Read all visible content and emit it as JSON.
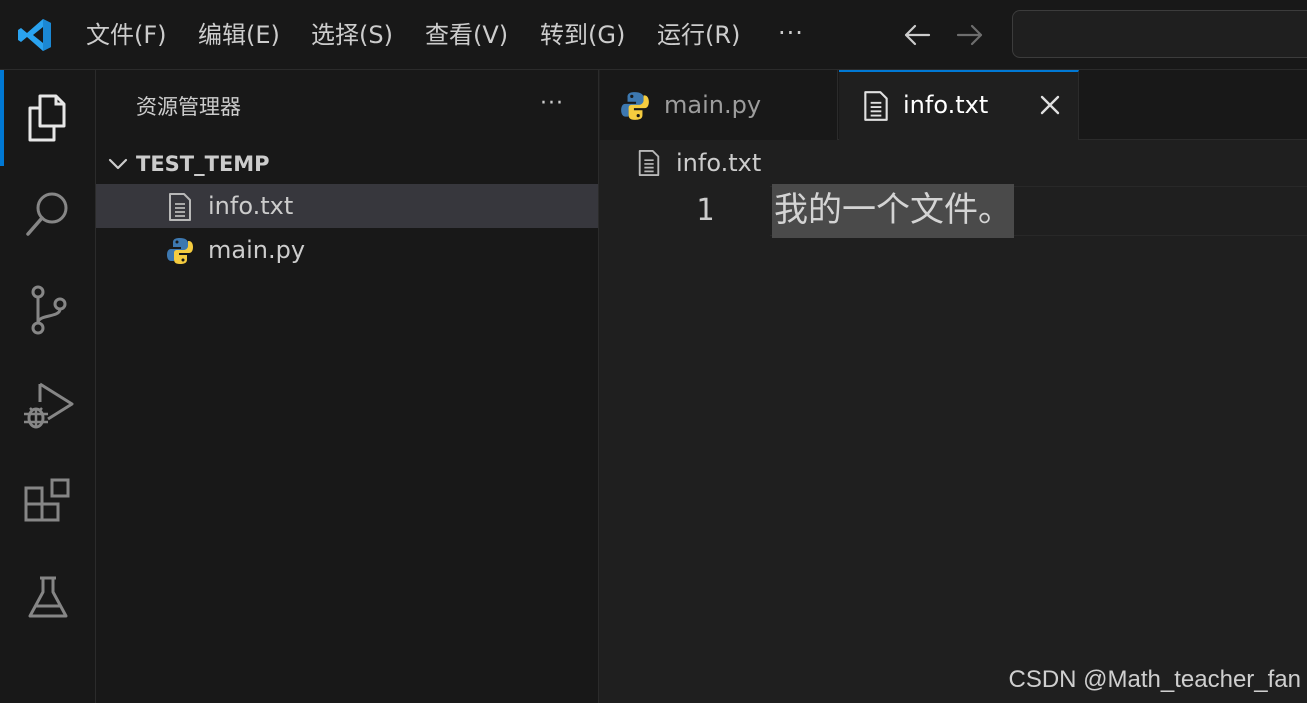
{
  "menu": {
    "items": [
      "文件(F)",
      "编辑(E)",
      "选择(S)",
      "查看(V)",
      "转到(G)",
      "运行(R)"
    ],
    "more": "···"
  },
  "activity_bar": {
    "icons": [
      "explorer-icon",
      "search-icon",
      "source-control-icon",
      "run-debug-icon",
      "extensions-icon",
      "testing-icon"
    ]
  },
  "explorer": {
    "title": "资源管理器",
    "more": "···",
    "folder": "TEST_TEMP",
    "files": [
      {
        "name": "info.txt",
        "icon": "text-file-icon",
        "selected": true
      },
      {
        "name": "main.py",
        "icon": "python-icon",
        "selected": false
      }
    ]
  },
  "tabs": [
    {
      "label": "main.py",
      "icon": "python-icon",
      "active": false
    },
    {
      "label": "info.txt",
      "icon": "text-file-icon",
      "active": true
    }
  ],
  "breadcrumb": {
    "label": "info.txt"
  },
  "editor": {
    "lines": [
      {
        "number": "1",
        "text": "我的一个文件。"
      }
    ]
  },
  "colors": {
    "accent": "#0078d4",
    "background": "#1f1f1f",
    "sidebar": "#181818",
    "selection": "#37373d"
  },
  "watermark": "CSDN @Math_teacher_fan"
}
